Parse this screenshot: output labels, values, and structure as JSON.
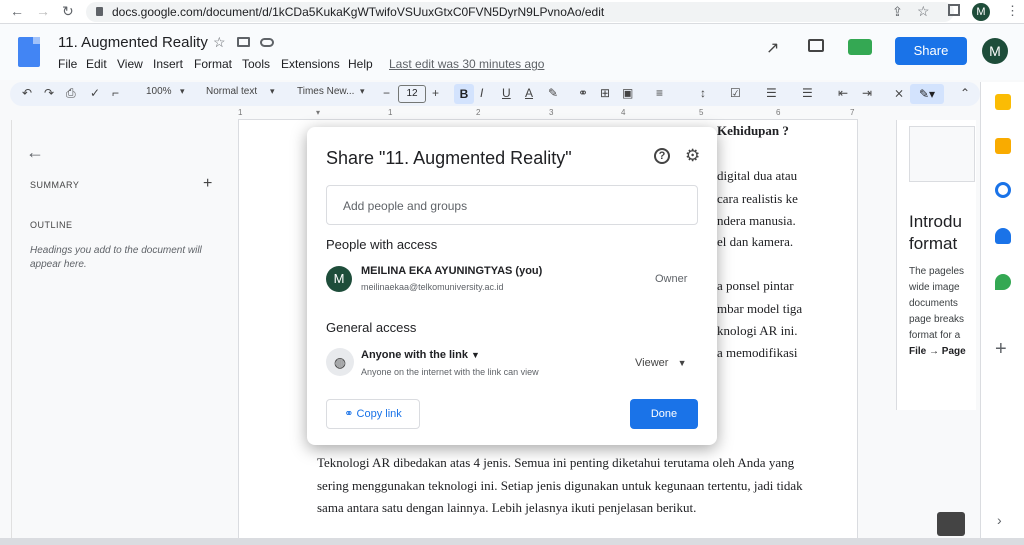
{
  "browser": {
    "url": "docs.google.com/document/d/1kCDa5KukaKgWTwifoVSUuxGtxC0FVN5DyrN9LPvnoAo/edit",
    "back_icon": "←",
    "forward_icon": "→",
    "reload_icon": "↻",
    "profile_initial": "M"
  },
  "header": {
    "title": "11. Augmented Reality",
    "menus": [
      "File",
      "Edit",
      "View",
      "Insert",
      "Format",
      "Tools",
      "Extensions",
      "Help"
    ],
    "last_edit": "Last edit was 30 minutes ago",
    "share_label": "Share",
    "avatar_initial": "M"
  },
  "toolbar": {
    "zoom": "100%",
    "style": "Normal text",
    "font": "Times New...",
    "font_size": "12",
    "bold": "B",
    "italic": "I",
    "underline": "U",
    "text_color": "A"
  },
  "ruler": {
    "marks": [
      "1",
      "1",
      "2",
      "3",
      "4",
      "5",
      "6",
      "7"
    ]
  },
  "outline": {
    "summary_label": "SUMMARY",
    "outline_label": "OUTLINE",
    "hint": "Headings you add to the document will appear here."
  },
  "document": {
    "lines_right": [
      "Kehidupan ?",
      "digital dua atau",
      "cara realistis ke",
      "ndera manusia.",
      "el dan kamera.",
      "a ponsel pintar",
      "mbar model tiga",
      "knologi AR ini.",
      "a memodifikasi"
    ],
    "para": [
      "Teknologi AR dibedakan atas 4 jenis. Semua ini penting diketahui terutama oleh Anda yang",
      "sering menggunakan teknologi ini. Setiap jenis digunakan untuk kegunaan tertentu, jadi tidak",
      "sama antara satu dengan lainnya. Lebih jelasnya ikuti penjelasan berikut."
    ]
  },
  "right_panel": {
    "heading_line1": "Introdu",
    "heading_line2": "format",
    "body": [
      "The pageles",
      "wide image",
      "documents",
      "page breaks",
      "format for a",
      "File → Page"
    ]
  },
  "dialog": {
    "title": "Share \"11. Augmented Reality\"",
    "input_placeholder": "Add people and groups",
    "people_heading": "People with access",
    "user_initial": "M",
    "user_name": "MEILINA EKA AYUNINGTYAS (you)",
    "user_email": "meilinaekaa@telkomuniversity.ac.id",
    "user_role": "Owner",
    "general_heading": "General access",
    "link_scope": "Anyone with the link",
    "link_desc": "Anyone on the internet with the link can view",
    "link_role": "Viewer",
    "copy_link_label": "Copy link",
    "done_label": "Done"
  },
  "colors": {
    "accent": "#1a73e8",
    "avatar": "#1e4d3a"
  }
}
